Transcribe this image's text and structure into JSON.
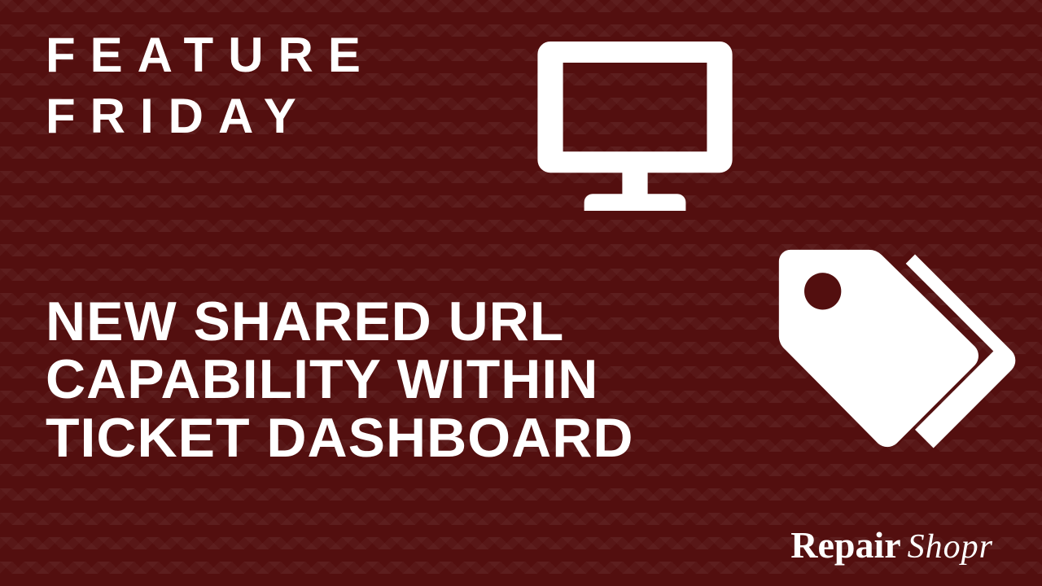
{
  "kicker": "FEATURE\nFRIDAY",
  "headline": "NEW SHARED URL\nCAPABILITY WITHIN\nTICKET DASHBOARD",
  "brand": {
    "main": "Repair",
    "sub": "Shopr"
  },
  "icons": {
    "monitor": "monitor-icon",
    "tags": "tags-icon"
  },
  "colors": {
    "background": "#530F0F",
    "text": "#FFFFFF"
  }
}
